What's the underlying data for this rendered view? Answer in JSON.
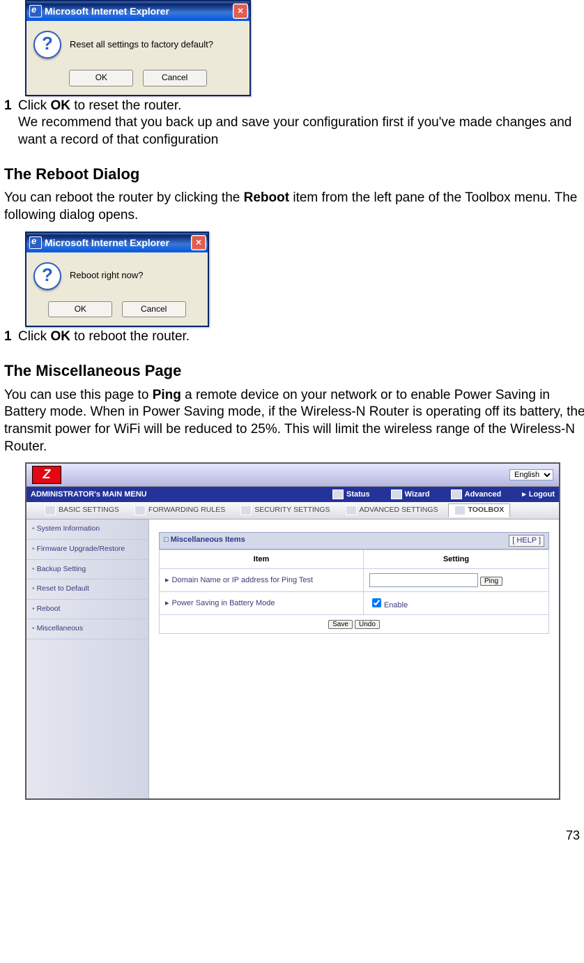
{
  "dialog1": {
    "title": "Microsoft Internet Explorer",
    "message": "Reset all settings to factory default?",
    "ok": "OK",
    "cancel": "Cancel"
  },
  "step1": {
    "num": "1",
    "line1a": "Click ",
    "line1b": "OK",
    "line1c": " to reset the router.",
    "line2": "We recommend that you back up and save your configuration first if you've made changes and want a record of that configuration"
  },
  "reboot_heading": "The Reboot Dialog",
  "reboot_para_a": "You can reboot the router by clicking the ",
  "reboot_para_b": "Reboot",
  "reboot_para_c": " item from the left pane of the Toolbox menu. The following dialog opens.",
  "dialog2": {
    "title": "Microsoft Internet Explorer",
    "message": "Reboot right now?",
    "ok": "OK",
    "cancel": "Cancel"
  },
  "step2": {
    "num": "1",
    "a": "Click ",
    "b": "OK",
    "c": " to reboot the router."
  },
  "misc_heading": "The Miscellaneous Page",
  "misc_para_a": "You can use this page to ",
  "misc_para_b": "Ping",
  "misc_para_c": " a remote device on your network or to enable Power Saving in Battery mode. When in Power Saving mode, if the Wireless-N Router is operating off its battery, the transmit power for WiFi will be reduced to 25%. This will limit the wireless range of the Wireless-N Router.",
  "router": {
    "logo": "Z",
    "lang": "English",
    "admin_title": "ADMINISTRATOR's MAIN MENU",
    "nav": {
      "status": "Status",
      "wizard": "Wizard",
      "advanced": "Advanced",
      "logout": "Logout"
    },
    "tabs": {
      "basic": "BASIC SETTINGS",
      "forwarding": "FORWARDING RULES",
      "security": "SECURITY SETTINGS",
      "advanced": "ADVANCED SETTINGS",
      "toolbox": "TOOLBOX"
    },
    "sidebar": [
      "System Information",
      "Firmware Upgrade/Restore",
      "Backup Setting",
      "Reset to Default",
      "Reboot",
      "Miscellaneous"
    ],
    "panel_title": "Miscellaneous Items",
    "help": "[ HELP ]",
    "col_item": "Item",
    "col_setting": "Setting",
    "row1": "Domain Name or IP address for Ping Test",
    "ping_btn": "Ping",
    "row2": "Power Saving in Battery Mode",
    "enable": "Enable",
    "save": "Save",
    "undo": "Undo"
  },
  "page_number": "73"
}
